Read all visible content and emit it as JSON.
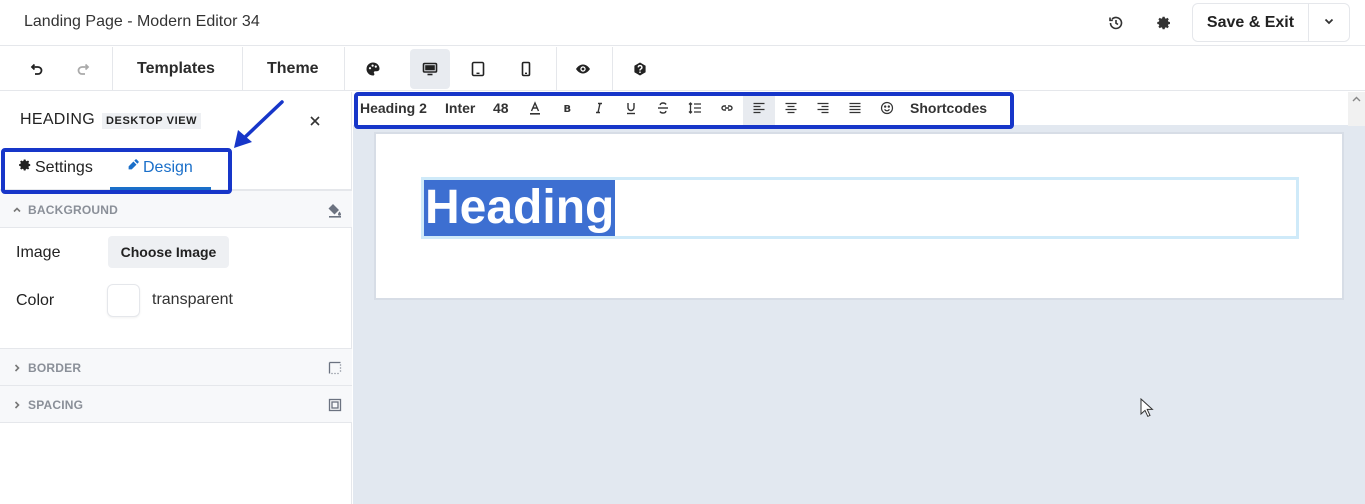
{
  "topbar": {
    "title": "Landing Page - Modern Editor 34",
    "icons": [
      "history-icon",
      "gear-icon"
    ],
    "save_label": "Save & Exit"
  },
  "toolbar": {
    "templates_label": "Templates",
    "theme_label": "Theme",
    "icons": [
      "undo-icon",
      "redo-icon",
      "palette-icon",
      "desktop-icon",
      "tablet-icon",
      "mobile-icon",
      "eye-icon",
      "help-icon"
    ],
    "active_device": "desktop"
  },
  "panel": {
    "title": "HEADING",
    "view_badge": "DESKTOP VIEW",
    "tabs": [
      {
        "label": "Settings",
        "icon": "gear-icon"
      },
      {
        "label": "Design",
        "icon": "paint-icon"
      }
    ],
    "active_tab": "Design",
    "sections": {
      "background": "BACKGROUND",
      "border": "BORDER",
      "spacing": "SPACING"
    },
    "image_label": "Image",
    "choose_image_label": "Choose Image",
    "color_label": "Color",
    "color_value": "transparent"
  },
  "format_bar": {
    "heading_level": "Heading 2",
    "font": "Inter",
    "font_size": "48",
    "shortcodes_label": "Shortcodes",
    "active_align": "left"
  },
  "canvas": {
    "heading_text": "Heading"
  },
  "colors": {
    "accent": "#1a6fc9",
    "selection": "#3d6fd1",
    "annotation": "#1736c9",
    "canvas_bg": "#e2e8f0"
  }
}
